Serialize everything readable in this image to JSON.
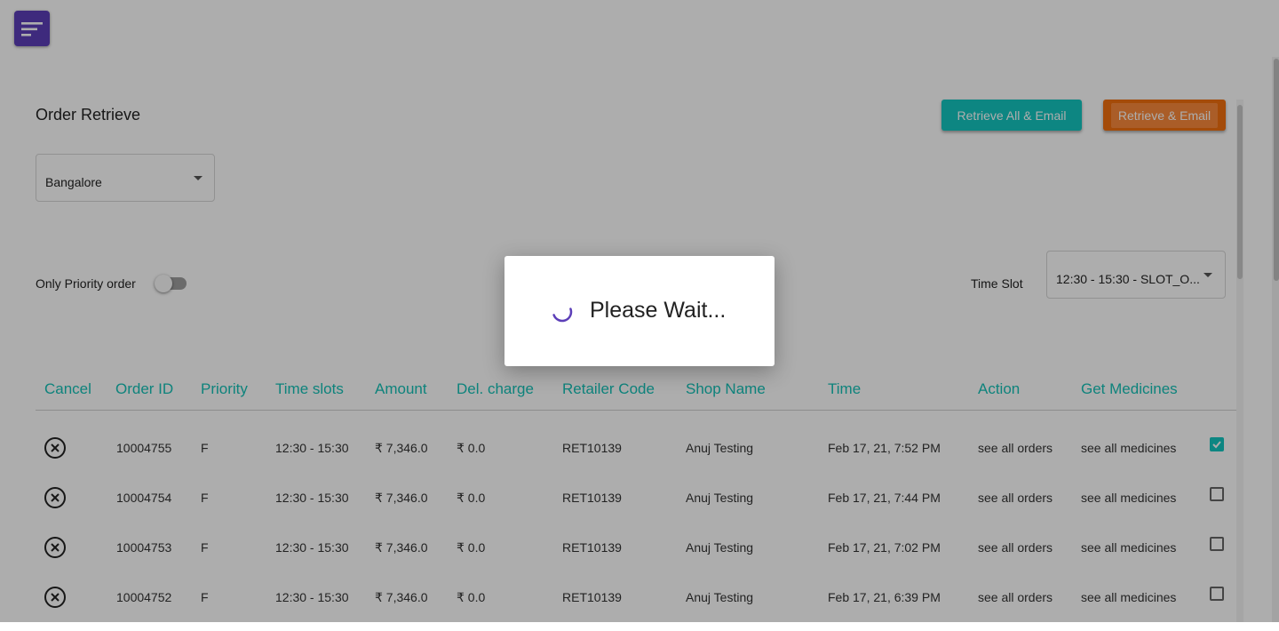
{
  "app": {
    "menu_icon": "menu-icon",
    "page_title": "Order Retrieve"
  },
  "actions": {
    "retrieve_all_label": "Retrieve All & Email",
    "retrieve_label": "Retrieve & Email",
    "colors": {
      "teal": "#14c6c0",
      "orange": "#f26f0e"
    }
  },
  "filters": {
    "city": "Bangalore",
    "only_priority_label": "Only Priority order",
    "only_priority_on": false,
    "time_slot_label": "Time Slot",
    "time_slot_value": "12:30 - 15:30 - SLOT_O..."
  },
  "table": {
    "headers": {
      "cancel": "Cancel",
      "order_id": "Order ID",
      "priority": "Priority",
      "time_slots": "Time slots",
      "amount": "Amount",
      "del_charge": "Del. charge",
      "retailer_code": "Retailer Code",
      "shop_name": "Shop Name",
      "time": "Time",
      "action": "Action",
      "get_medicines": "Get Medicines"
    },
    "rows": [
      {
        "order_id": "10004755",
        "priority": "F",
        "time_slot": "12:30 - 15:30",
        "amount": "₹ 7,346.0",
        "del_charge": "₹ 0.0",
        "retailer_code": "RET10139",
        "shop_name": "Anuj Testing",
        "time": "Feb 17, 21, 7:52 PM",
        "action": "see all orders",
        "medicines": "see all medicines",
        "checked": true
      },
      {
        "order_id": "10004754",
        "priority": "F",
        "time_slot": "12:30 - 15:30",
        "amount": "₹ 7,346.0",
        "del_charge": "₹ 0.0",
        "retailer_code": "RET10139",
        "shop_name": "Anuj Testing",
        "time": "Feb 17, 21, 7:44 PM",
        "action": "see all orders",
        "medicines": "see all medicines",
        "checked": false
      },
      {
        "order_id": "10004753",
        "priority": "F",
        "time_slot": "12:30 - 15:30",
        "amount": "₹ 7,346.0",
        "del_charge": "₹ 0.0",
        "retailer_code": "RET10139",
        "shop_name": "Anuj Testing",
        "time": "Feb 17, 21, 7:02 PM",
        "action": "see all orders",
        "medicines": "see all medicines",
        "checked": false
      },
      {
        "order_id": "10004752",
        "priority": "F",
        "time_slot": "12:30 - 15:30",
        "amount": "₹ 7,346.0",
        "del_charge": "₹ 0.0",
        "retailer_code": "RET10139",
        "shop_name": "Anuj Testing",
        "time": "Feb 17, 21, 6:39 PM",
        "action": "see all orders",
        "medicines": "see all medicines",
        "checked": false
      }
    ],
    "header_color": "#15c2b7"
  },
  "dialog": {
    "text": "Please Wait...",
    "spinner_icon": "spinner-icon",
    "spinner_color": "#5c3fb8"
  }
}
